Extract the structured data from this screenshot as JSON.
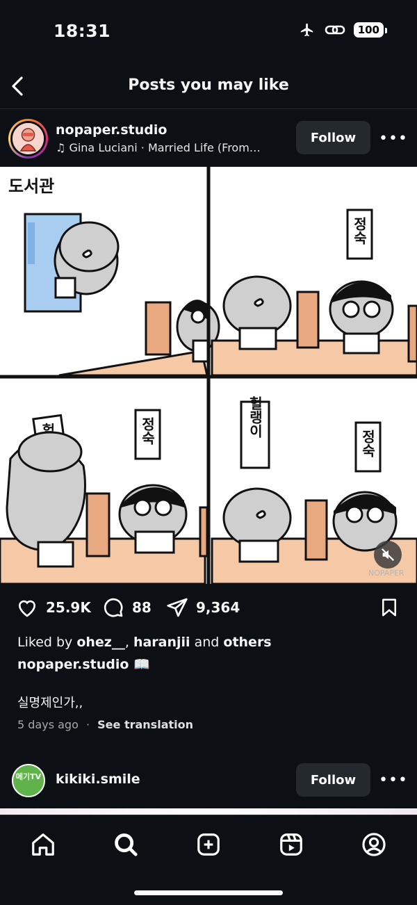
{
  "status_bar": {
    "time": "18:31",
    "battery": "100"
  },
  "header": {
    "title": "Posts you may like"
  },
  "post": {
    "username": "nopaper.studio",
    "audio": "Gina Luciani · Married Life (From…",
    "follow_label": "Follow",
    "comic_texts": {
      "panel1": "도서관",
      "sign": "정숙",
      "sign2": "헐",
      "sign_long": "헐랭이",
      "watermark": "NOPAPER"
    },
    "likes": "25.9K",
    "comments": "88",
    "shares": "9,364",
    "liked_by_prefix": "Liked by ",
    "liked_by_user1": "ohez__",
    "liked_by_sep": ", ",
    "liked_by_user2": "haranjii",
    "liked_by_and": " and ",
    "liked_by_others": "others",
    "caption": "nopaper.studio 📖",
    "caption_text": "실명제인가,,",
    "time_ago": "5 days ago",
    "dot": "·",
    "see_translation": "See translation"
  },
  "next_post": {
    "username": "kikiki.smile",
    "avatar_text": "메기TV",
    "follow_label": "Follow"
  },
  "tabs": [
    "home-icon",
    "search-icon",
    "create-icon",
    "reels-icon",
    "profile-icon"
  ],
  "colors": {
    "background": "#0c1014",
    "button": "#24292e",
    "table": "#f6c9a6",
    "divider": "#e8a77a"
  }
}
